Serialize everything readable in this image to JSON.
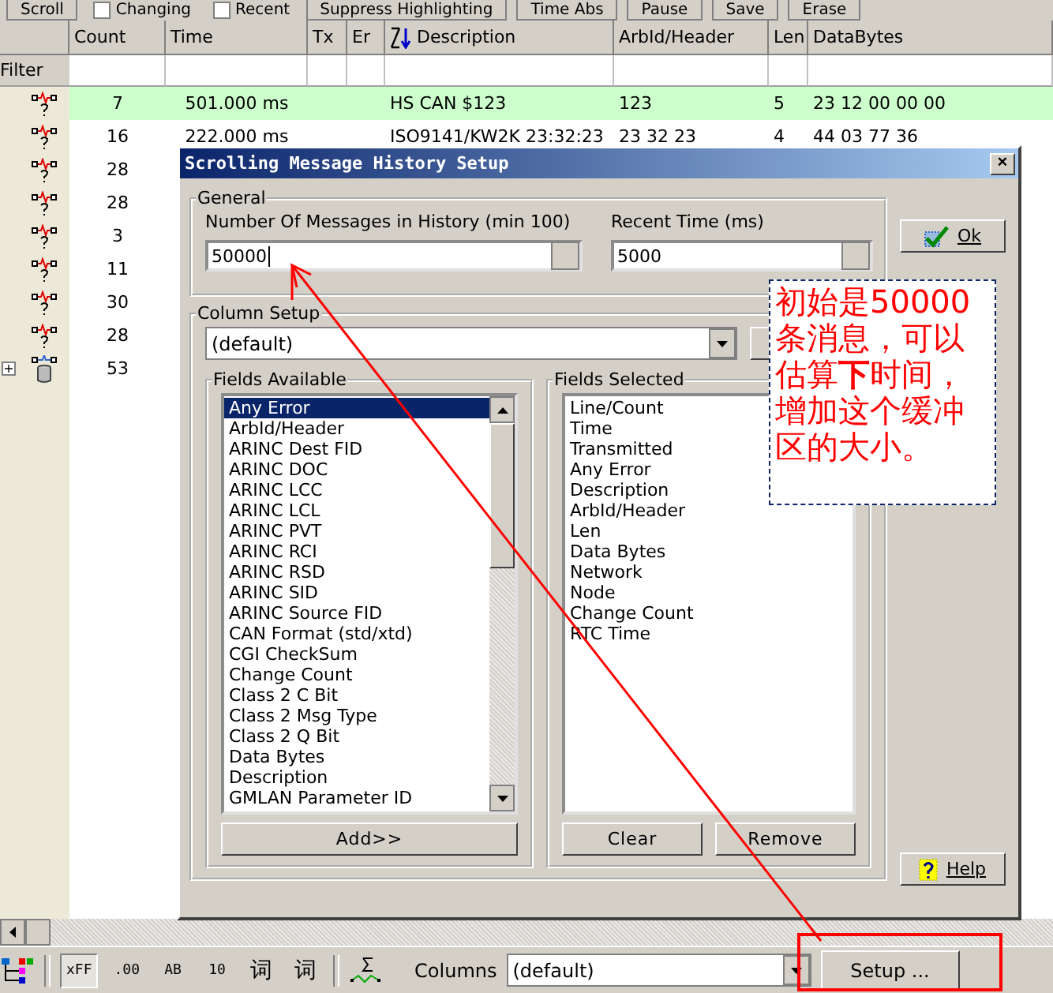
{
  "toolbar": {
    "items": [
      {
        "label": "Scroll",
        "kind": "button"
      },
      {
        "label": "Changing",
        "kind": "checkbox",
        "checked": false
      },
      {
        "label": "Recent",
        "kind": "checkbox",
        "checked": false
      },
      {
        "label": "Suppress Highlighting",
        "kind": "button"
      },
      {
        "label": "Time Abs",
        "kind": "button"
      },
      {
        "label": "Pause",
        "kind": "button"
      },
      {
        "label": "Save",
        "kind": "button"
      },
      {
        "label": "Erase",
        "kind": "button"
      }
    ]
  },
  "grid": {
    "columns": [
      "Count",
      "Time",
      "Tx",
      "Er",
      "Description",
      "ArbId/Header",
      "Len",
      "DataBytes"
    ],
    "filter_label": "Filter",
    "rows": [
      {
        "kind": "message",
        "highlighted": true,
        "cells": [
          "7",
          "501.000 ms",
          "",
          "",
          "HS CAN $123",
          "123",
          "5",
          "23 12 00 00 00"
        ]
      },
      {
        "kind": "message",
        "highlighted": false,
        "cells": [
          "16",
          "222.000 ms",
          "",
          "",
          "ISO9141/KW2K 23:32:23",
          "23 32 23",
          "4",
          "44 03 77 36"
        ]
      },
      {
        "kind": "message",
        "highlighted": false,
        "cells": [
          "28"
        ]
      },
      {
        "kind": "message",
        "highlighted": false,
        "cells": [
          "28"
        ]
      },
      {
        "kind": "message",
        "highlighted": false,
        "cells": [
          "3"
        ]
      },
      {
        "kind": "message",
        "highlighted": false,
        "cells": [
          "11"
        ]
      },
      {
        "kind": "message",
        "highlighted": false,
        "cells": [
          "30"
        ]
      },
      {
        "kind": "message",
        "highlighted": false,
        "cells": [
          "28"
        ]
      },
      {
        "kind": "database",
        "highlighted": false,
        "expander": "+",
        "cells": [
          "53"
        ]
      }
    ]
  },
  "dialog": {
    "title": "Scrolling Message History Setup",
    "close_button": "×",
    "general": {
      "title": "General",
      "history_label": "Number Of Messages in History (min 100)",
      "history_value": "50000",
      "recent_label": "Recent Time (ms)",
      "recent_value": "5000"
    },
    "column_setup": {
      "title": "Column Setup",
      "preset": "(default)",
      "available": {
        "title": "Fields Available",
        "button": "Add>>",
        "items": [
          {
            "label": "Any Error",
            "selected": true
          },
          {
            "label": "ArbId/Header",
            "selected": false
          },
          {
            "label": "ARINC Dest FID",
            "selected": false
          },
          {
            "label": "ARINC DOC",
            "selected": false
          },
          {
            "label": "ARINC LCC",
            "selected": false
          },
          {
            "label": "ARINC LCL",
            "selected": false
          },
          {
            "label": "ARINC PVT",
            "selected": false
          },
          {
            "label": "ARINC RCI",
            "selected": false
          },
          {
            "label": "ARINC RSD",
            "selected": false
          },
          {
            "label": "ARINC SID",
            "selected": false
          },
          {
            "label": "ARINC Source FID",
            "selected": false
          },
          {
            "label": "CAN Format (std/xtd)",
            "selected": false
          },
          {
            "label": "CGI CheckSum",
            "selected": false
          },
          {
            "label": "Change Count",
            "selected": false
          },
          {
            "label": "Class 2 C Bit",
            "selected": false
          },
          {
            "label": "Class 2 Msg Type",
            "selected": false
          },
          {
            "label": "Class 2 Q Bit",
            "selected": false
          },
          {
            "label": "Data Bytes",
            "selected": false
          },
          {
            "label": "Description",
            "selected": false
          },
          {
            "label": "GMLAN Parameter ID",
            "selected": false
          }
        ]
      },
      "selected_fields": {
        "title": "Fields Selected",
        "buttons": [
          "Clear",
          "Remove"
        ],
        "items": [
          {
            "label": "Line/Count",
            "selected": false
          },
          {
            "label": "Time",
            "selected": false
          },
          {
            "label": "Transmitted",
            "selected": false
          },
          {
            "label": "Any Error",
            "selected": false
          },
          {
            "label": "Description",
            "selected": false
          },
          {
            "label": "ArbId/Header",
            "selected": false
          },
          {
            "label": "Len",
            "selected": false
          },
          {
            "label": "Data Bytes",
            "selected": false
          },
          {
            "label": "Network",
            "selected": false
          },
          {
            "label": "Node",
            "selected": false
          },
          {
            "label": "Change Count",
            "selected": false
          },
          {
            "label": "RTC Time",
            "selected": false
          }
        ]
      }
    },
    "ok_button": "Ok",
    "help_button": "Help"
  },
  "annotation": {
    "text": "初始是50000条消息，可以估算**下**时间，增加这个缓冲区的大小。"
  },
  "bottom_toolbar": {
    "format_buttons": [
      {
        "label": "xFF",
        "selected": true
      },
      {
        "label": ".00",
        "selected": false
      },
      {
        "label": "AB",
        "selected": false
      },
      {
        "label": "10",
        "selected": false
      },
      {
        "label": "词",
        "selected": false
      },
      {
        "label": "词",
        "selected": false
      }
    ],
    "columns_label": "Columns",
    "columns_value": "(default)",
    "setup_button": "Setup ..."
  }
}
